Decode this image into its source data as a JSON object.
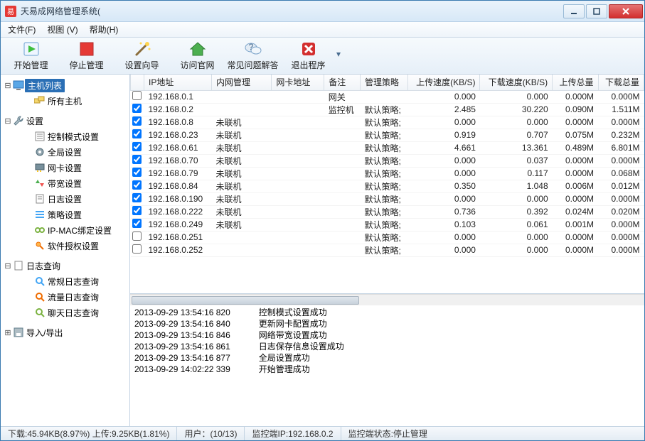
{
  "title": "天易成网络管理系统(",
  "menu": {
    "file": "文件(F)",
    "view": "视图 (V)",
    "help": "帮助(H)"
  },
  "toolbar": {
    "start": "开始管理",
    "stop": "停止管理",
    "wizard": "设置向导",
    "website": "访问官网",
    "faq": "常见问题解答",
    "exit": "退出程序"
  },
  "tree": {
    "hosts": {
      "label": "主机列表",
      "all": "所有主机"
    },
    "settings": {
      "label": "设置",
      "ctrlmode": "控制模式设置",
      "global": "全局设置",
      "nic": "网卡设置",
      "bandwidth": "带宽设置",
      "log": "日志设置",
      "policy": "策略设置",
      "ipmac": "IP-MAC绑定设置",
      "license": "软件授权设置"
    },
    "logquery": {
      "label": "日志查询",
      "normal": "常规日志查询",
      "traffic": "流量日志查询",
      "chat": "聊天日志查询"
    },
    "importexport": "导入/导出"
  },
  "columns": {
    "ip": "IP地址",
    "lan": "内网管理",
    "mac": "网卡地址",
    "note": "备注",
    "policy": "管理策略",
    "up_speed": "上传速度(KB/S)",
    "down_speed": "下载速度(KB/S)",
    "up_total": "上传总量",
    "down_total": "下载总量"
  },
  "rows": [
    {
      "chk": false,
      "ip": "192.168.0.1",
      "lan": "",
      "mac": "",
      "note": "网关",
      "policy": "",
      "up": "0.000",
      "down": "0.000",
      "upt": "0.000M",
      "dnt": "0.000M"
    },
    {
      "chk": true,
      "ip": "192.168.0.2",
      "lan": "",
      "mac": "",
      "note": "监控机",
      "policy": "默认策略;",
      "up": "2.485",
      "down": "30.220",
      "upt": "0.090M",
      "dnt": "1.511M"
    },
    {
      "chk": true,
      "ip": "192.168.0.8",
      "lan": "未联机",
      "mac": "",
      "note": "",
      "policy": "默认策略;",
      "up": "0.000",
      "down": "0.000",
      "upt": "0.000M",
      "dnt": "0.000M"
    },
    {
      "chk": true,
      "ip": "192.168.0.23",
      "lan": "未联机",
      "mac": "",
      "note": "",
      "policy": "默认策略;",
      "up": "0.919",
      "down": "0.707",
      "upt": "0.075M",
      "dnt": "0.232M"
    },
    {
      "chk": true,
      "ip": "192.168.0.61",
      "lan": "未联机",
      "mac": "",
      "note": "",
      "policy": "默认策略;",
      "up": "4.661",
      "down": "13.361",
      "upt": "0.489M",
      "dnt": "6.801M"
    },
    {
      "chk": true,
      "ip": "192.168.0.70",
      "lan": "未联机",
      "mac": "",
      "note": "",
      "policy": "默认策略;",
      "up": "0.000",
      "down": "0.037",
      "upt": "0.000M",
      "dnt": "0.000M"
    },
    {
      "chk": true,
      "ip": "192.168.0.79",
      "lan": "未联机",
      "mac": "",
      "note": "",
      "policy": "默认策略;",
      "up": "0.000",
      "down": "0.117",
      "upt": "0.000M",
      "dnt": "0.068M"
    },
    {
      "chk": true,
      "ip": "192.168.0.84",
      "lan": "未联机",
      "mac": "",
      "note": "",
      "policy": "默认策略;",
      "up": "0.350",
      "down": "1.048",
      "upt": "0.006M",
      "dnt": "0.012M"
    },
    {
      "chk": true,
      "ip": "192.168.0.190",
      "lan": "未联机",
      "mac": "",
      "note": "",
      "policy": "默认策略;",
      "up": "0.000",
      "down": "0.000",
      "upt": "0.000M",
      "dnt": "0.000M"
    },
    {
      "chk": true,
      "ip": "192.168.0.222",
      "lan": "未联机",
      "mac": "",
      "note": "",
      "policy": "默认策略;",
      "up": "0.736",
      "down": "0.392",
      "upt": "0.024M",
      "dnt": "0.020M"
    },
    {
      "chk": true,
      "ip": "192.168.0.249",
      "lan": "未联机",
      "mac": "",
      "note": "",
      "policy": "默认策略;",
      "up": "0.103",
      "down": "0.061",
      "upt": "0.001M",
      "dnt": "0.000M"
    },
    {
      "chk": false,
      "ip": "192.168.0.251",
      "lan": "",
      "mac": "",
      "note": "",
      "policy": "默认策略;",
      "up": "0.000",
      "down": "0.000",
      "upt": "0.000M",
      "dnt": "0.000M"
    },
    {
      "chk": false,
      "ip": "192.168.0.252",
      "lan": "",
      "mac": "",
      "note": "",
      "policy": "默认策略;",
      "up": "0.000",
      "down": "0.000",
      "upt": "0.000M",
      "dnt": "0.000M"
    }
  ],
  "log": [
    {
      "ts": "2013-09-29 13:54:16 820",
      "msg": "控制模式设置成功"
    },
    {
      "ts": "2013-09-29 13:54:16 840",
      "msg": "更新网卡配置成功"
    },
    {
      "ts": "2013-09-29 13:54:16 846",
      "msg": "网络带宽设置成功"
    },
    {
      "ts": "2013-09-29 13:54:16 861",
      "msg": "日志保存信息设置成功"
    },
    {
      "ts": "2013-09-29 13:54:16 877",
      "msg": "全局设置成功"
    },
    {
      "ts": "2013-09-29 14:02:22 339",
      "msg": "开始管理成功"
    }
  ],
  "status": {
    "net": "下载:45.94KB(8.97%) 上传:9.25KB(1.81%)",
    "users": "用户：(10/13)",
    "monip": "监控端IP:192.168.0.2",
    "monstate": "监控端状态:停止管理"
  }
}
